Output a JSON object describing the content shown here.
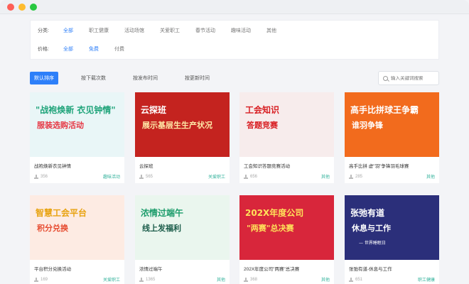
{
  "filters": {
    "category": {
      "label": "分类:",
      "options": [
        "全部",
        "职工健康",
        "活动场馆",
        "关爱职工",
        "春节活动",
        "趣味活动",
        "其他"
      ],
      "active": 0
    },
    "price": {
      "label": "价格:",
      "options": [
        "全部",
        "免费",
        "付费"
      ],
      "active": [
        0,
        1
      ]
    }
  },
  "sort": {
    "options": [
      "默认排序",
      "按下载次数",
      "按发布时间",
      "按更新时间"
    ],
    "active": 0
  },
  "search": {
    "placeholder": "输入关键词搜索"
  },
  "cards": [
    {
      "title": "战袍焕新衣见钟情",
      "downloads": "356",
      "tag": "趣味活动",
      "poster": {
        "line1": "\"战袍焕新 衣见钟情\"",
        "line2": "服装选购活动",
        "bg": "#e9f6f7",
        "c1": "#1fa47a",
        "c2": "#e63946"
      }
    },
    {
      "title": "云探班",
      "downloads": "565",
      "tag": "关爱职工",
      "poster": {
        "line1": "云探班",
        "line2": "展示基层生生产状况",
        "bg": "#c4231f",
        "c1": "#ffffff",
        "c2": "#ffe9a8"
      }
    },
    {
      "title": "工会知识答题竞赛活动",
      "downloads": "656",
      "tag": "其他",
      "poster": {
        "line1": "工会知识",
        "line2": "答题竞赛",
        "bg": "#f7ecec",
        "c1": "#d81e22",
        "c2": "#d81e22"
      }
    },
    {
      "title": "高手比拼 虚\"羽\"争锋羽毛球赛",
      "downloads": "285",
      "tag": "其他",
      "poster": {
        "line1": "高手比拼球王争霸",
        "line2": "谁羽争锋",
        "bg": "#f26b1d",
        "c1": "#ffffff",
        "c2": "#ffffff"
      }
    },
    {
      "title": "平台积分兑换活动",
      "downloads": "169",
      "tag": "关爱职工",
      "poster": {
        "line1": "智慧工会平台",
        "line2": "积分兑换",
        "bg": "#fdebe3",
        "c1": "#e8a312",
        "c2": "#e64a2e"
      }
    },
    {
      "title": "浓情过端午",
      "downloads": "1365",
      "tag": "其他",
      "poster": {
        "line1": "浓情过端午",
        "line2": "线上发福利",
        "bg": "#eaf6ee",
        "c1": "#1c9c6b",
        "c2": "#1b5c4a"
      }
    },
    {
      "title": "202X年度公司\"两赛\"总决赛",
      "downloads": "368",
      "tag": "其他",
      "poster": {
        "line1": "202X年度公司",
        "line2": "\"两赛\"总决赛",
        "bg": "#d8263b",
        "c1": "#ffe25a",
        "c2": "#ffe25a"
      }
    },
    {
      "title": "张弛有道-休息与工作",
      "downloads": "651",
      "tag": "职工健康",
      "poster": {
        "line1": "张弛有道",
        "line2": "休息与工作",
        "line3": "— 世界睡眠日",
        "bg": "#2b2f7a",
        "c1": "#ffffff",
        "c2": "#ffffff"
      }
    }
  ]
}
